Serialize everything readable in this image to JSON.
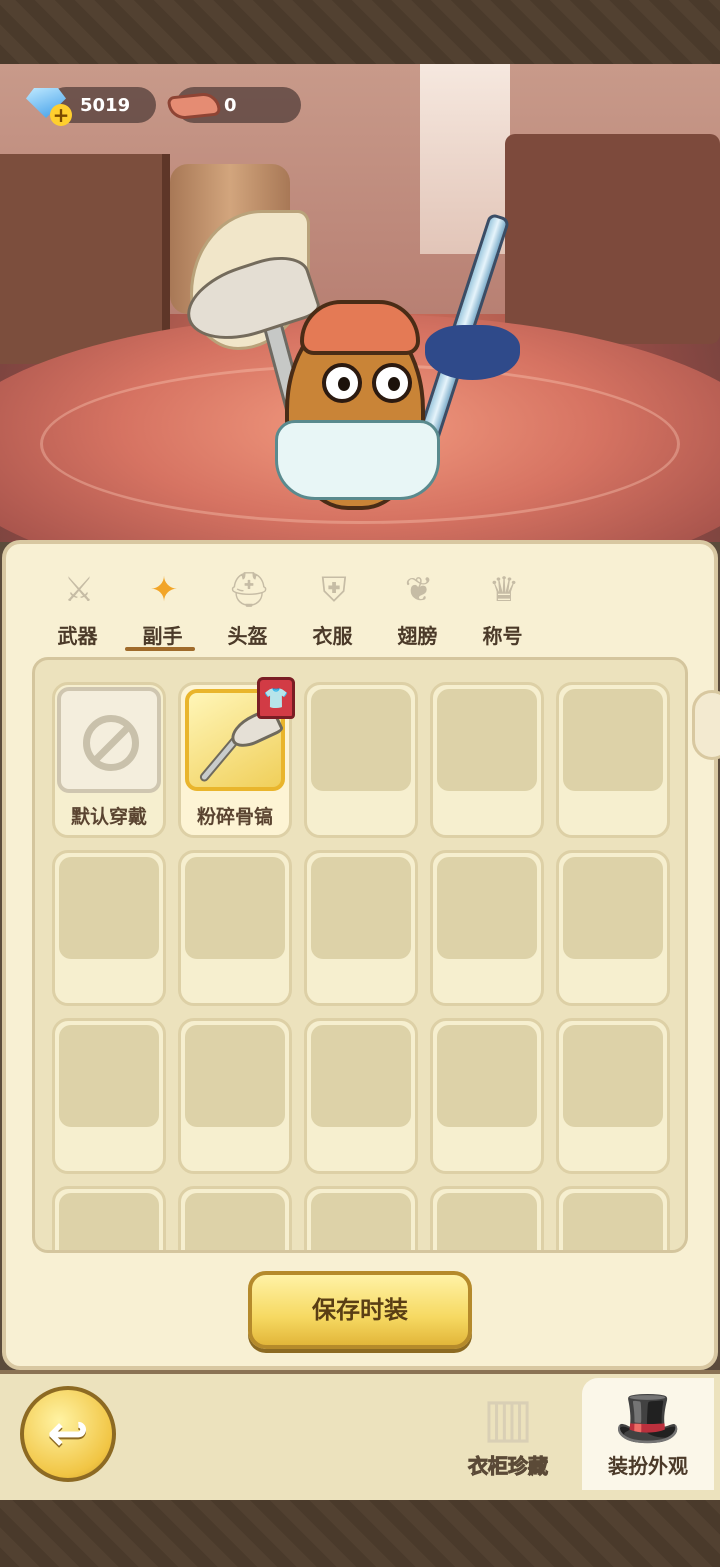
{
  "currencies": {
    "gems": "5019",
    "meat": "0"
  },
  "tabs": [
    {
      "label": "武器",
      "icon": "sword-icon"
    },
    {
      "label": "副手",
      "icon": "offhand-icon"
    },
    {
      "label": "头盔",
      "icon": "helmet-icon"
    },
    {
      "label": "衣服",
      "icon": "armor-icon"
    },
    {
      "label": "翅膀",
      "icon": "wings-icon"
    },
    {
      "label": "称号",
      "icon": "crown-icon"
    }
  ],
  "active_tab": "副手",
  "slots": [
    {
      "caption": "默认穿戴",
      "type": "default",
      "icon": "no-entry-icon"
    },
    {
      "caption": "粉碎骨镐",
      "type": "equipped",
      "icon": "bone-pickaxe-icon",
      "badge": "shirt-badge-icon"
    }
  ],
  "save_button": "保存时装",
  "bottom_nav": {
    "back": "back-arrow-icon",
    "wardrobe": "衣柜珍藏",
    "dress_up": "装扮外观"
  },
  "colors": {
    "accent": "#f2a528",
    "panel": "#f8f0d3",
    "button_gold": "#f6d962",
    "text_dark": "#4b3a29"
  }
}
